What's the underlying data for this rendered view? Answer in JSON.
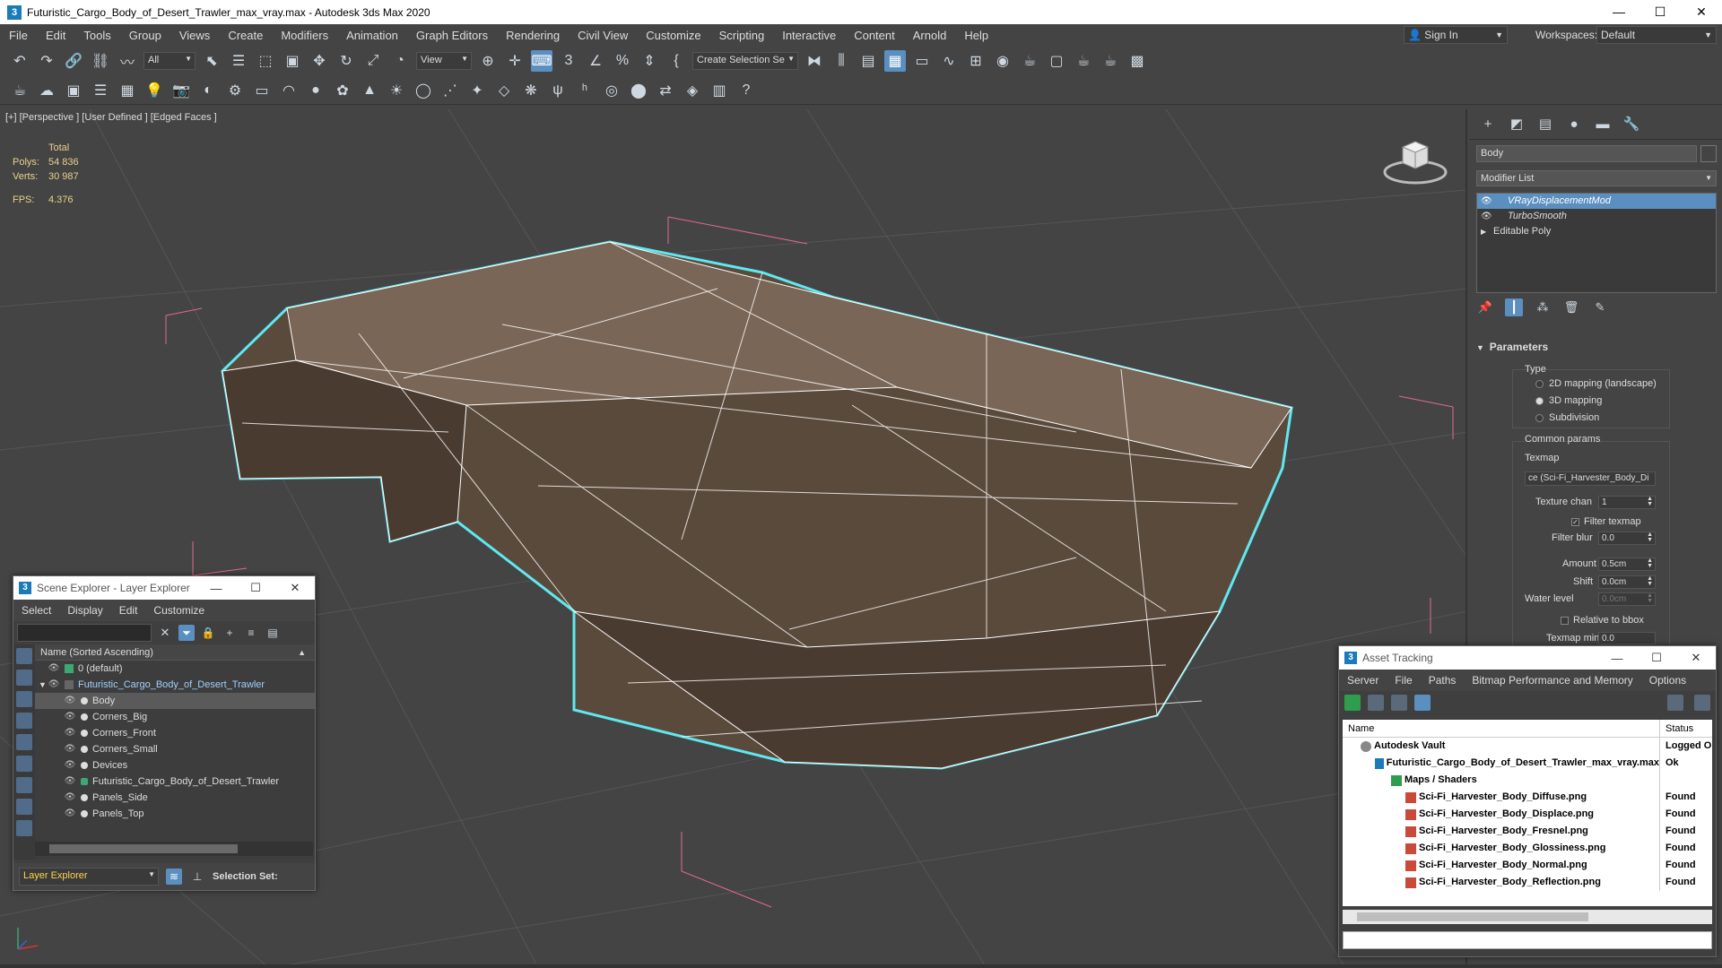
{
  "window": {
    "title": "Futuristic_Cargo_Body_of_Desert_Trawler_max_vray.max - Autodesk 3ds Max 2020",
    "app_icon": "3",
    "minimize": "—",
    "maximize": "☐",
    "close": "✕"
  },
  "menu": {
    "items": [
      "File",
      "Edit",
      "Tools",
      "Group",
      "Views",
      "Create",
      "Modifiers",
      "Animation",
      "Graph Editors",
      "Rendering",
      "Civil View",
      "Customize",
      "Scripting",
      "Interactive",
      "Content",
      "Arnold",
      "Help"
    ],
    "sign_in": "Sign In",
    "workspaces_label": "Workspaces:",
    "workspace_value": "Default"
  },
  "toolbar": {
    "filter_all": "All",
    "view_dropdown": "View",
    "selection_set": "Create Selection Se"
  },
  "viewport": {
    "label": "[+] [Perspective ] [User Defined ] [Edged Faces ]",
    "stats_header": "Total",
    "polys_label": "Polys:",
    "polys_value": "54 836",
    "verts_label": "Verts:",
    "verts_value": "30 987",
    "fps_label": "FPS:",
    "fps_value": "4.376"
  },
  "scene_explorer": {
    "title": "Scene Explorer - Layer Explorer",
    "icon": "3",
    "menu": [
      "Select",
      "Display",
      "Edit",
      "Customize"
    ],
    "column_header": "Name (Sorted Ascending)",
    "rows": [
      {
        "name": "0 (default)"
      },
      {
        "name": "Futuristic_Cargo_Body_of_Desert_Trawler"
      },
      {
        "name": "Body"
      },
      {
        "name": "Corners_Big"
      },
      {
        "name": "Corners_Front"
      },
      {
        "name": "Corners_Small"
      },
      {
        "name": "Devices"
      },
      {
        "name": "Futuristic_Cargo_Body_of_Desert_Trawler"
      },
      {
        "name": "Panels_Side"
      },
      {
        "name": "Panels_Top"
      }
    ],
    "footer_dropdown": "Layer Explorer",
    "selection_set_label": "Selection Set:"
  },
  "asset_tracking": {
    "title": "Asset Tracking",
    "icon": "3",
    "menu": [
      "Server",
      "File",
      "Paths",
      "Bitmap Performance and Memory",
      "Options"
    ],
    "col_name": "Name",
    "col_status": "Status",
    "rows": [
      {
        "name": "Autodesk Vault",
        "status": "Logged O"
      },
      {
        "name": "Futuristic_Cargo_Body_of_Desert_Trawler_max_vray.max",
        "status": "Ok"
      },
      {
        "name": "Maps / Shaders",
        "status": ""
      },
      {
        "name": "Sci-Fi_Harvester_Body_Diffuse.png",
        "status": "Found"
      },
      {
        "name": "Sci-Fi_Harvester_Body_Displace.png",
        "status": "Found"
      },
      {
        "name": "Sci-Fi_Harvester_Body_Fresnel.png",
        "status": "Found"
      },
      {
        "name": "Sci-Fi_Harvester_Body_Glossiness.png",
        "status": "Found"
      },
      {
        "name": "Sci-Fi_Harvester_Body_Normal.png",
        "status": "Found"
      },
      {
        "name": "Sci-Fi_Harvester_Body_Reflection.png",
        "status": "Found"
      }
    ]
  },
  "command_panel": {
    "object_name": "Body",
    "modifier_list": "Modifier List",
    "stack": [
      {
        "name": "VRayDisplacementMod"
      },
      {
        "name": "TurboSmooth"
      },
      {
        "name": "Editable Poly"
      }
    ],
    "rollout": "Parameters",
    "type_label": "Type",
    "radio_2d": "2D mapping (landscape)",
    "radio_3d": "3D mapping",
    "radio_sub": "Subdivision",
    "common_params": "Common params",
    "texmap_label": "Texmap",
    "texmap_value": "ce (Sci-Fi_Harvester_Body_Di",
    "texture_chan_label": "Texture chan",
    "texture_chan_value": "1",
    "filter_texmap": "Filter texmap",
    "filter_blur_label": "Filter blur",
    "filter_blur_value": "0.0",
    "amount_label": "Amount",
    "amount_value": "0.5cm",
    "shift_label": "Shift",
    "shift_value": "0.0cm",
    "water_level_label": "Water level",
    "water_level_value": "0.0cm",
    "relative_bbox": "Relative to bbox",
    "texmap_min_label": "Texmap min",
    "texmap_min_value": "0.0"
  },
  "colors": {
    "accent": "#5b8fbf",
    "selection_outline": "#5fe8f0",
    "grid": "#555555",
    "bounding_box": "#e06b8b"
  }
}
